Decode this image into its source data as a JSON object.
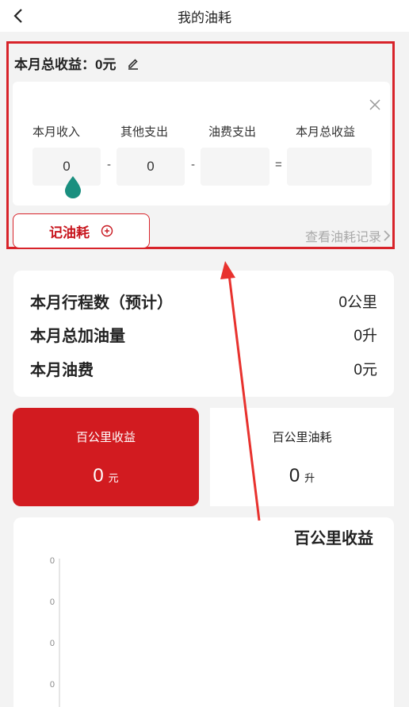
{
  "header": {
    "title": "我的油耗",
    "back_icon": "chevron-left-icon"
  },
  "summary": {
    "title": "本月总收益：0元",
    "edit_icon": "pencil-icon",
    "close_icon": "close-icon",
    "columns": [
      {
        "label": "本月收入",
        "value": "0"
      },
      {
        "label": "其他支出",
        "value": "0"
      },
      {
        "label": "油费支出",
        "value": ""
      },
      {
        "label": "本月总收益",
        "value": ""
      }
    ],
    "operators": [
      "-",
      "-",
      "="
    ],
    "record_button": "记油耗",
    "record_icon": "plus-circle-icon",
    "view_link": "查看油耗记录",
    "view_icon": "chevron-right-icon"
  },
  "stats": [
    {
      "label": "本月行程数（预计）",
      "value": "0公里"
    },
    {
      "label": "本月总加油量",
      "value": "0升"
    },
    {
      "label": "本月油费",
      "value": "0元"
    }
  ],
  "metrics": {
    "income": {
      "label": "百公里收益",
      "value": "0",
      "unit": "元"
    },
    "fuel": {
      "label": "百公里油耗",
      "value": "0",
      "unit": "升"
    }
  },
  "chart": {
    "title": "百公里收益",
    "y_tick_labels": [
      "0",
      "0",
      "0",
      "0"
    ]
  },
  "colors": {
    "accent": "#d21b20",
    "drop": "#1a8f7f",
    "link": "#a9a9a9"
  }
}
